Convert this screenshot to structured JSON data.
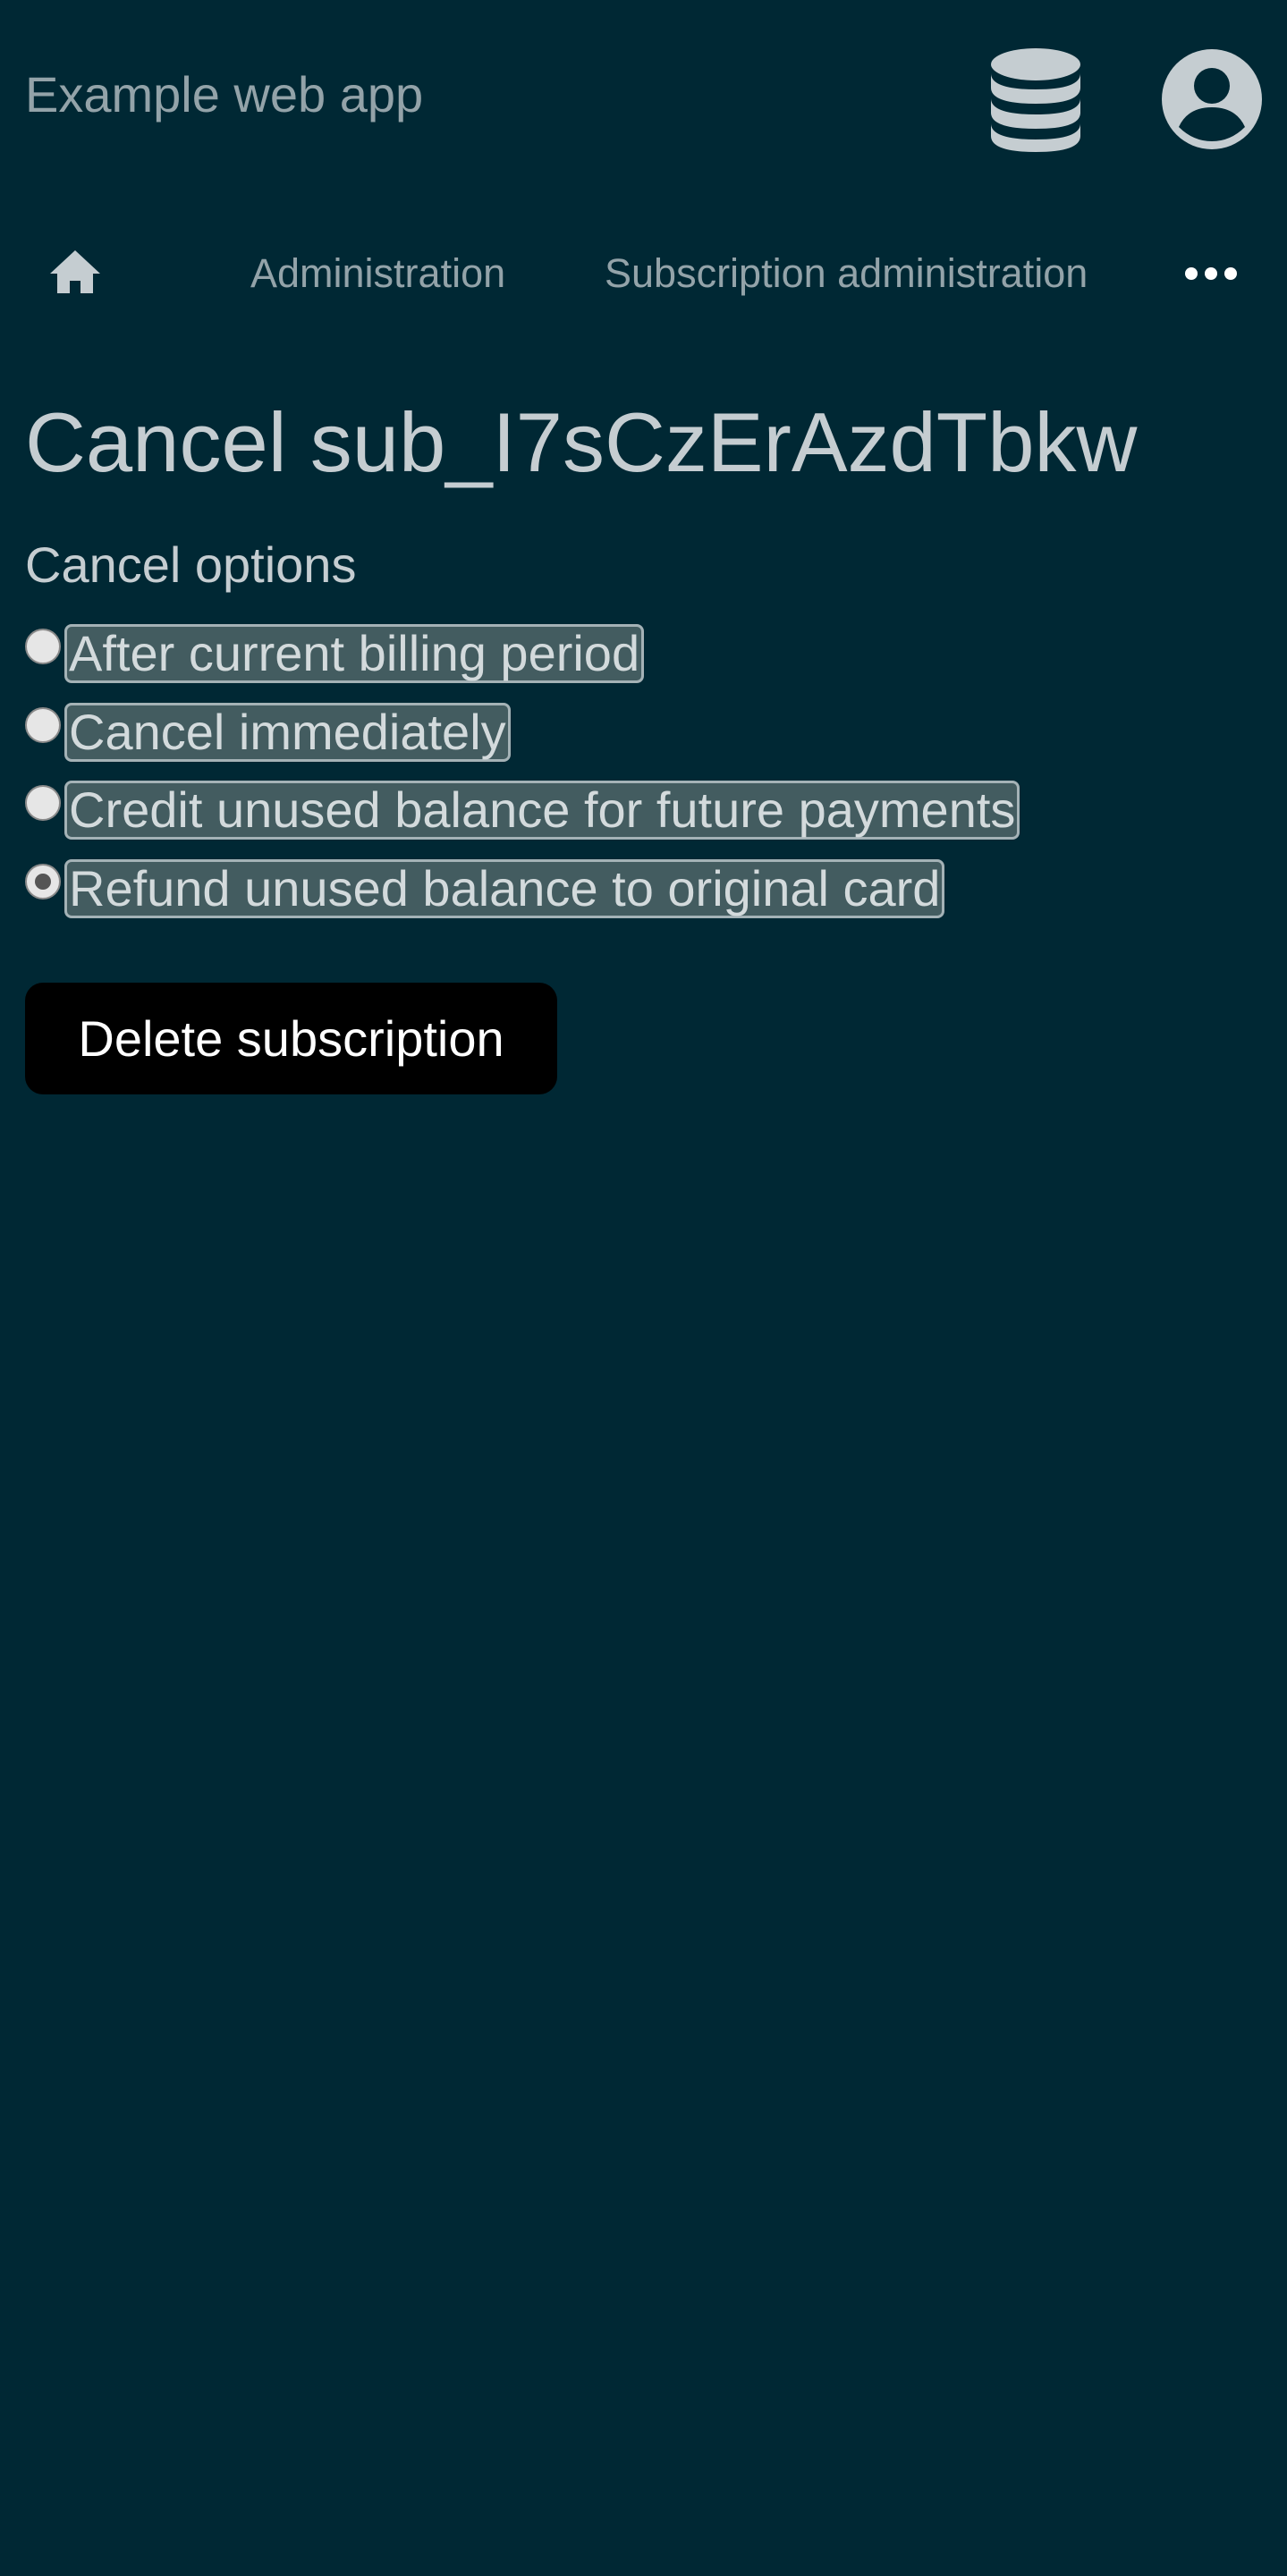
{
  "header": {
    "app_title": "Example web app",
    "icons": [
      "database-icon",
      "user-avatar-icon"
    ]
  },
  "nav": {
    "home_icon": "home-icon",
    "items": [
      {
        "label": "Administration"
      },
      {
        "label": "Subscription administration"
      }
    ],
    "more_icon": "more-horizontal-icon"
  },
  "main": {
    "title": "Cancel sub_I7sCzErAzdTbkw",
    "cancel_options": {
      "legend": "Cancel options",
      "options": [
        {
          "label": "After current billing period",
          "checked": false
        },
        {
          "label": "Cancel immediately",
          "checked": false
        },
        {
          "label": "Credit unused balance for future payments",
          "checked": false
        },
        {
          "label": "Refund unused balance to original card",
          "checked": true
        }
      ]
    },
    "delete_button": "Delete subscription"
  },
  "colors": {
    "background": "#002834",
    "text": "#c5cdd1",
    "muted_text": "#93a3a9",
    "option_label_bg": "#435c60",
    "option_label_border": "#a4b2b6",
    "button_bg": "#000000",
    "button_text": "#ffffff"
  }
}
